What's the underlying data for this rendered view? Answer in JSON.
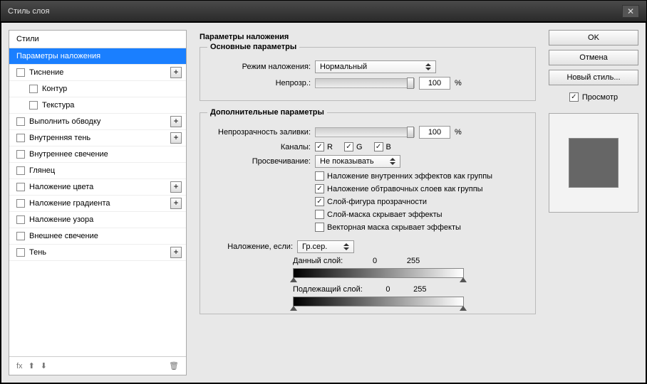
{
  "window": {
    "title": "Стиль слоя"
  },
  "sidebar": {
    "header": "Стили",
    "items": [
      {
        "label": "Параметры наложения",
        "selected": true
      },
      {
        "label": "Тиснение",
        "check": true,
        "add": true
      },
      {
        "label": "Контур",
        "check": true,
        "indent": true
      },
      {
        "label": "Текстура",
        "check": true,
        "indent": true
      },
      {
        "label": "Выполнить обводку",
        "check": true,
        "add": true
      },
      {
        "label": "Внутренняя тень",
        "check": true,
        "add": true
      },
      {
        "label": "Внутреннее свечение",
        "check": true
      },
      {
        "label": "Глянец",
        "check": true
      },
      {
        "label": "Наложение цвета",
        "check": true,
        "add": true
      },
      {
        "label": "Наложение градиента",
        "check": true,
        "add": true
      },
      {
        "label": "Наложение узора",
        "check": true
      },
      {
        "label": "Внешнее свечение",
        "check": true
      },
      {
        "label": "Тень",
        "check": true,
        "add": true
      }
    ],
    "footer": {
      "fx": "fx"
    }
  },
  "panel": {
    "title": "Параметры наложения",
    "basic": {
      "legend": "Основные параметры",
      "blendModeLabel": "Режим наложения:",
      "blendModeValue": "Нормальный",
      "opacityLabel": "Непрозр.:",
      "opacityValue": "100",
      "opacityUnit": "%"
    },
    "advanced": {
      "legend": "Дополнительные параметры",
      "fillOpacityLabel": "Непрозрачность заливки:",
      "fillOpacityValue": "100",
      "fillOpacityUnit": "%",
      "channelsLabel": "Каналы:",
      "channelR": "R",
      "channelG": "G",
      "channelB": "B",
      "knockoutLabel": "Просвечивание:",
      "knockoutValue": "Не показывать",
      "cb1": "Наложение внутренних эффектов как группы",
      "cb2": "Наложение обтравочных слоев как группы",
      "cb3": "Слой-фигура прозрачности",
      "cb4": "Слой-маска скрывает эффекты",
      "cb5": "Векторная маска скрывает эффекты",
      "blendIfLabel": "Наложение, если:",
      "blendIfValue": "Гр.сер.",
      "thisLayer": "Данный слой:",
      "thisLow": "0",
      "thisHigh": "255",
      "underLayer": "Подлежащий слой:",
      "underLow": "0",
      "underHigh": "255"
    }
  },
  "right": {
    "ok": "OK",
    "cancel": "Отмена",
    "newStyle": "Новый стиль...",
    "preview": "Просмотр"
  }
}
